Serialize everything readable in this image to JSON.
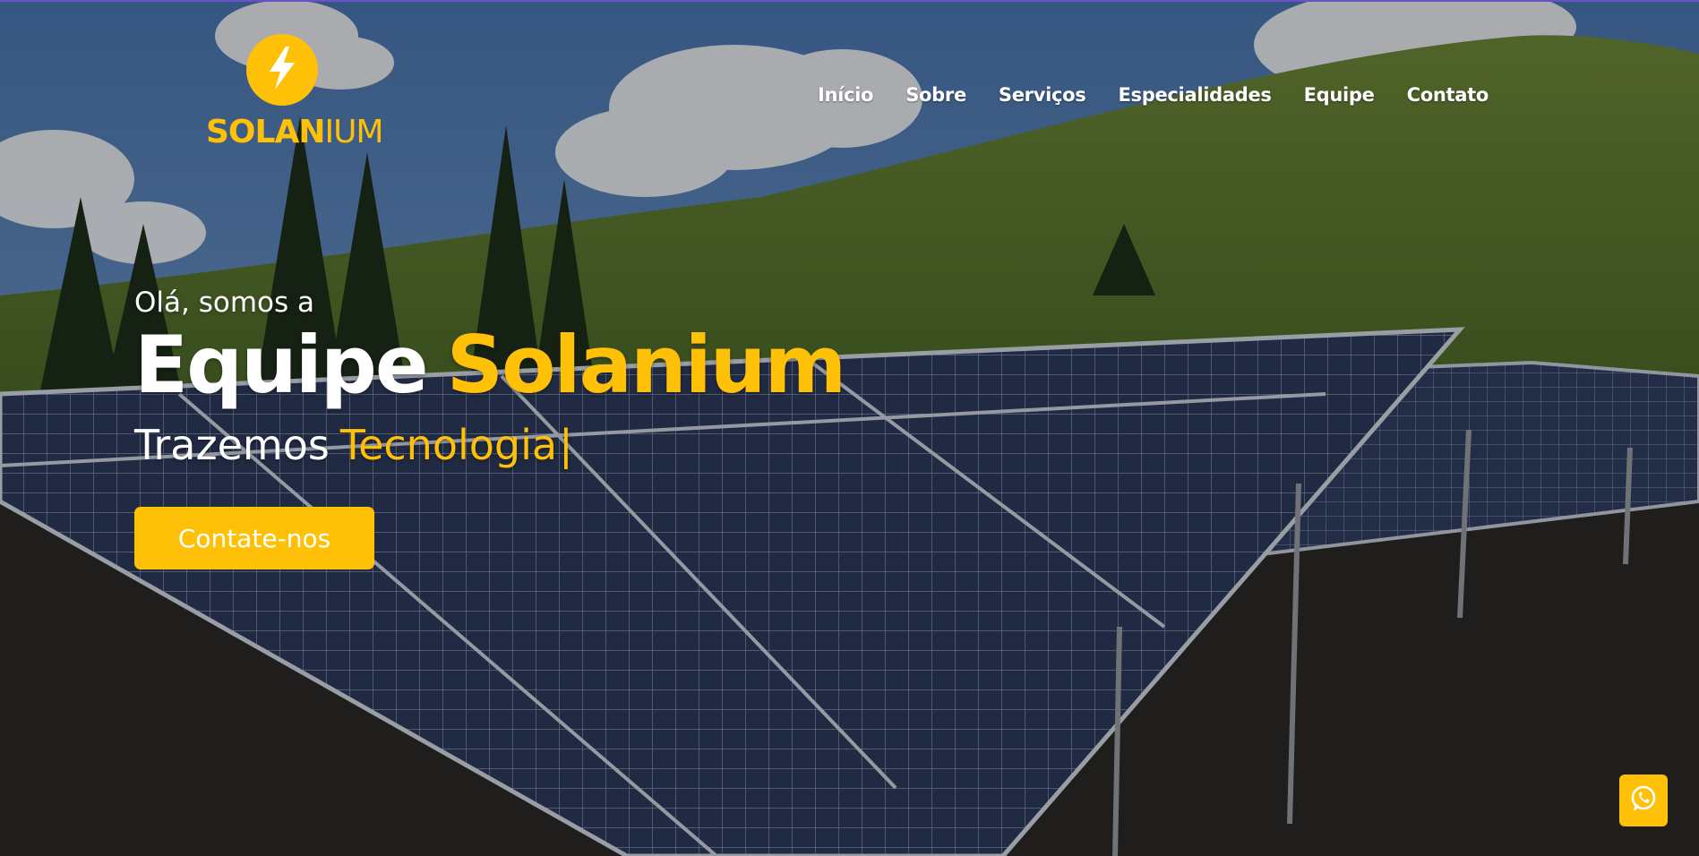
{
  "brand": {
    "name_main": "SOLAN",
    "name_suffix": "IUM",
    "logo_icon": "lightning-bolt-icon"
  },
  "nav": {
    "items": [
      {
        "label": "Início"
      },
      {
        "label": "Sobre"
      },
      {
        "label": "Serviços"
      },
      {
        "label": "Especialidades"
      },
      {
        "label": "Equipe"
      },
      {
        "label": "Contato"
      }
    ]
  },
  "hero": {
    "greeting": "Olá, somos a",
    "headline_part1": "Equipe",
    "headline_part2": "Solanium",
    "tagline_part1": "Trazemos",
    "tagline_part2": "Tecnologia",
    "cursor": "|",
    "cta_label": "Contate-nos",
    "background": "solar-panel-field-photo"
  },
  "floating": {
    "whatsapp_icon": "whatsapp-icon"
  },
  "colors": {
    "accent": "#FFC107",
    "text": "#FFFFFF",
    "topline": "#6A4FC7"
  }
}
